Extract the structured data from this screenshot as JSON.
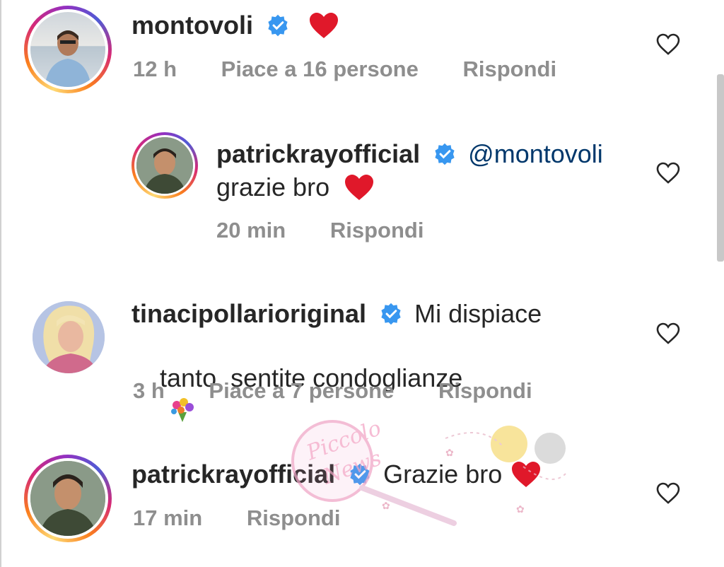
{
  "comments": [
    {
      "username": "montovoli",
      "text": "",
      "has_heart": true,
      "time": "12 h",
      "likes": "Piace a 16 persone",
      "reply": "Rispondi"
    },
    {
      "username": "patrickrayofficial",
      "mention": "@montovoli",
      "text": "grazie bro",
      "has_heart": true,
      "time": "20 min",
      "reply": "Rispondi"
    },
    {
      "username": "tinacipollarioriginal",
      "text_line1": "Mi dispiace",
      "text_line2": "tanto  sentite condoglianze",
      "time": "3 h",
      "likes": "Piace a 7 persone",
      "reply": "Rispondi"
    },
    {
      "username": "patrickrayofficial",
      "text": "Grazie bro",
      "has_heart": true,
      "time": "17 min",
      "reply": "Rispondi"
    }
  ],
  "watermark_text": "Piccolo News",
  "colors": {
    "text": "#262626",
    "secondary": "#8e8e8e",
    "mention": "#00376b",
    "verified": "#3897f0",
    "heart": "#e0182a"
  }
}
